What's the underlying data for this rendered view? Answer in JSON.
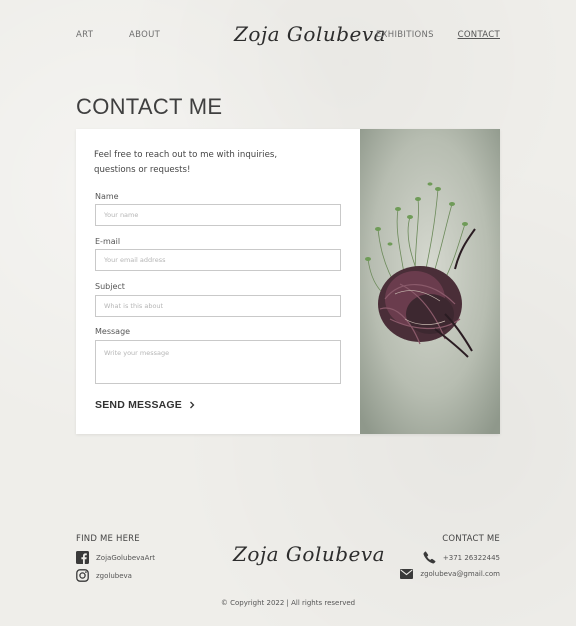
{
  "nav": {
    "items": [
      {
        "label": "ART"
      },
      {
        "label": "ABOUT"
      },
      {
        "label": "EXHIBITIONS"
      },
      {
        "label": "CONTACT",
        "active": true
      }
    ],
    "logo_text": "Zoja Golubeva"
  },
  "page": {
    "title": "CONTACT ME"
  },
  "form": {
    "intro": "Feel free to reach out to me with inquiries, questions or requests!",
    "fields": {
      "name": {
        "label": "Name",
        "placeholder": "Your name",
        "value": ""
      },
      "email": {
        "label": "E-mail",
        "placeholder": "Your email address",
        "value": ""
      },
      "subject": {
        "label": "Subject",
        "placeholder": "What is this about",
        "value": ""
      },
      "message": {
        "label": "Message",
        "placeholder": "Write your message",
        "value": ""
      }
    },
    "send_label": "SEND MESSAGE",
    "send_icon": "chevron-right-icon"
  },
  "artwork": {
    "description_icon": "artwork-image"
  },
  "footer": {
    "find_heading": "FIND ME HERE",
    "facebook": {
      "icon": "facebook-icon",
      "text": "ZojaGolubevaArt"
    },
    "instagram": {
      "icon": "instagram-icon",
      "text": "zgolubeva"
    },
    "logo_text": "Zoja Golubeva",
    "contact_heading": "CONTACT ME",
    "phone": {
      "icon": "phone-icon",
      "text": "+371 26322445"
    },
    "email": {
      "icon": "mail-icon",
      "text": "zgolubeva@gmail.com"
    },
    "copyright": "© Copyright 2022 | All rights reserved"
  },
  "colors": {
    "background": "#efeeea",
    "card": "#ffffff",
    "text": "#3a3a3a",
    "border": "#c9c9c9"
  }
}
